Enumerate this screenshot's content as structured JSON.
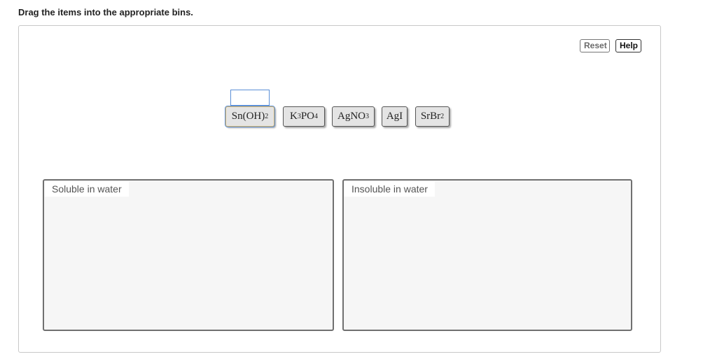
{
  "instruction": "Drag the items into the appropriate bins.",
  "toolbar": {
    "reset_label": "Reset",
    "help_label": "Help"
  },
  "tiles": [
    {
      "base": "Sn(OH)",
      "sub": "2",
      "tail": ""
    },
    {
      "base": "K",
      "sub": "3",
      "tail": "PO",
      "sub2": "4"
    },
    {
      "base": "AgNO",
      "sub": "3",
      "tail": ""
    },
    {
      "base": "AgI",
      "sub": "",
      "tail": ""
    },
    {
      "base": "SrBr",
      "sub": "2",
      "tail": ""
    }
  ],
  "bins": [
    {
      "label": "Soluble in water"
    },
    {
      "label": "Insoluble in water"
    }
  ]
}
